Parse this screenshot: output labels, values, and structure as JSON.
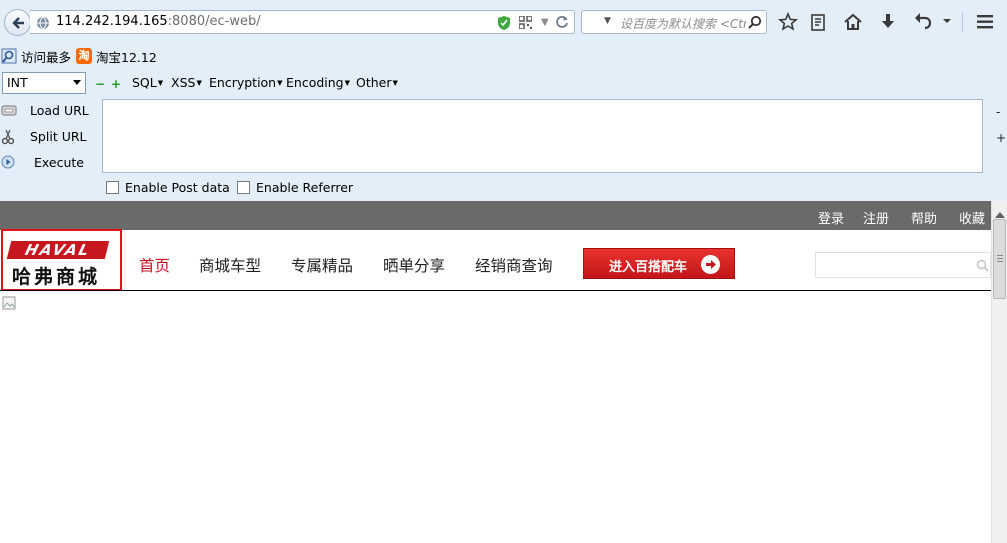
{
  "browser": {
    "url_host": "114.242.194.165",
    "url_rest": ":8080/ec-web/",
    "search_placeholder": "设百度为默认搜索 <Ctrl+K>",
    "bookmarks": [
      {
        "label": "访问最多",
        "icon": "most-visited-icon"
      },
      {
        "label": "淘宝12.12",
        "icon": "taobao-icon"
      }
    ],
    "toolbar_icons": [
      "bookmark-star-icon",
      "reading-list-icon",
      "home-icon",
      "download-icon",
      "undo-icon",
      "menu-icon"
    ]
  },
  "hackbar": {
    "select_value": "INT",
    "menus": [
      "SQL",
      "XSS",
      "Encryption",
      "Encoding",
      "Other"
    ],
    "actions": {
      "load_url": "Load URL",
      "split_url": "Split URL",
      "execute": "Execute"
    },
    "url_text": "",
    "edge_minus": "-",
    "edge_plus": "+",
    "enable_post": "Enable Post data",
    "enable_referrer": "Enable Referrer",
    "enable_post_checked": false,
    "enable_referrer_checked": false
  },
  "site": {
    "top_links": [
      "登录",
      "注册",
      "帮助",
      "收藏"
    ],
    "logo": {
      "brand": "HAVAL",
      "name": "哈弗商城"
    },
    "nav": [
      "首页",
      "商城车型",
      "专属精品",
      "晒单分享",
      "经销商查询"
    ],
    "nav_active_index": 0,
    "cta_label": "进入百搭配车",
    "search_value": "",
    "colors": {
      "accent": "#c81623",
      "topbar": "#6a6a6a",
      "cta": "#d4211f"
    }
  }
}
